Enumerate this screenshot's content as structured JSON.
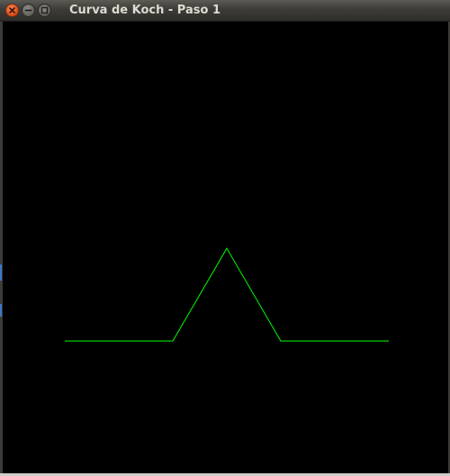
{
  "window": {
    "title": "Curva de Koch - Paso 1",
    "controls": [
      {
        "name": "close",
        "icon": "close-icon",
        "color": "#e2541f"
      },
      {
        "name": "minimize",
        "icon": "minimize-icon",
        "color": "#67655f"
      },
      {
        "name": "maximize",
        "icon": "maximize-icon",
        "color": "#67655f"
      }
    ]
  },
  "canvas": {
    "background": "#000000",
    "curve_color": "#00ff00",
    "koch_step": 1
  }
}
